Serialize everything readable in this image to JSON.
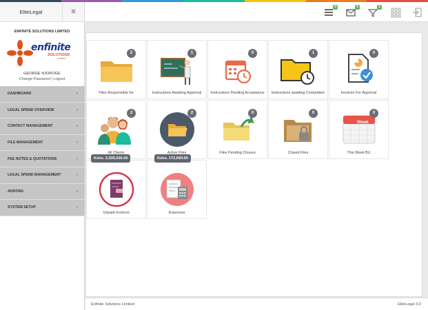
{
  "colors": {
    "strip": [
      "#34495e",
      "#9b59b6",
      "#3498db",
      "#1abc9c",
      "#f1c40f",
      "#e67e22",
      "#e74c3c"
    ],
    "sidebar_nav_bg": "#c5c5c5",
    "badge_bg": "#6a6f76",
    "topbar_badge_bg": "#5cb85c"
  },
  "brand": {
    "name": "EliteLegal",
    "menu_icon": "hamburger-icon"
  },
  "company": {
    "name": "ENFINITE SOLUTIONS LIMITED",
    "logo_text": "enfinite",
    "logo_sub": "SOLUTIONS",
    "logo_sub2": "Limited"
  },
  "user": {
    "name": "GEORGE NJOROGE",
    "change_password": "Change Password",
    "separator": "|",
    "logout": "Logout"
  },
  "nav": [
    {
      "label": "DASHBOARD"
    },
    {
      "label": "LEGAL SPEND OVERVIEW"
    },
    {
      "label": "CONTACT MANAGEMENT"
    },
    {
      "label": "FILE MANAGEMENT"
    },
    {
      "label": "FEE NOTES & QUOTATIONS"
    },
    {
      "label": "LEGAL SPEND MANAGEMENT"
    },
    {
      "label": "ADDONS"
    },
    {
      "label": "SYSTEM SETUP"
    }
  ],
  "topbar": [
    {
      "icon": "inbox-icon",
      "badge": "0"
    },
    {
      "icon": "mail-icon",
      "badge": "0"
    },
    {
      "icon": "filter-icon",
      "badge": "2"
    },
    {
      "icon": "apps-grid-icon",
      "badge": ""
    },
    {
      "icon": "sign-out-icon",
      "badge": ""
    }
  ],
  "tiles": [
    {
      "label": "Files Responsible for",
      "badge": "2",
      "icon": "folder-icon"
    },
    {
      "label": "Instructions Awaiting Approval",
      "badge": "1",
      "icon": "presentation-board-icon"
    },
    {
      "label": "Instructions Pending Acceptance",
      "badge": "0",
      "icon": "calendar-clock-icon"
    },
    {
      "label": "Instructions awaiting Completion",
      "badge": "1",
      "icon": "folder-clock-icon"
    },
    {
      "label": "Invoices For Approval",
      "badge": "0",
      "icon": "document-check-icon"
    },
    {
      "label": "All Clients",
      "badge": "2",
      "icon": "clients-group-icon"
    },
    {
      "label": "Active Files",
      "badge": "2",
      "icon": "open-folder-icon"
    },
    {
      "label": "Files Pending Closure",
      "badge": "0",
      "icon": "folder-arrow-icon"
    },
    {
      "label": "Closed Files",
      "badge": "0",
      "icon": "locked-folder-icon"
    },
    {
      "label": "This Week BU",
      "badge": "0",
      "icon": "week-calendar-icon",
      "week_text": "Week"
    },
    {
      "label": "Unpaid Invoices",
      "amount": "Kshs. 2,026,030.00",
      "icon": "unpaid-invoice-icon"
    },
    {
      "label": "Expenses",
      "amount": "Kshs. 172,000.00",
      "icon": "expenses-calculator-icon"
    }
  ],
  "footer": {
    "company": "Enfinite Solutions Limited",
    "version": "EliteLegal 3.0"
  }
}
